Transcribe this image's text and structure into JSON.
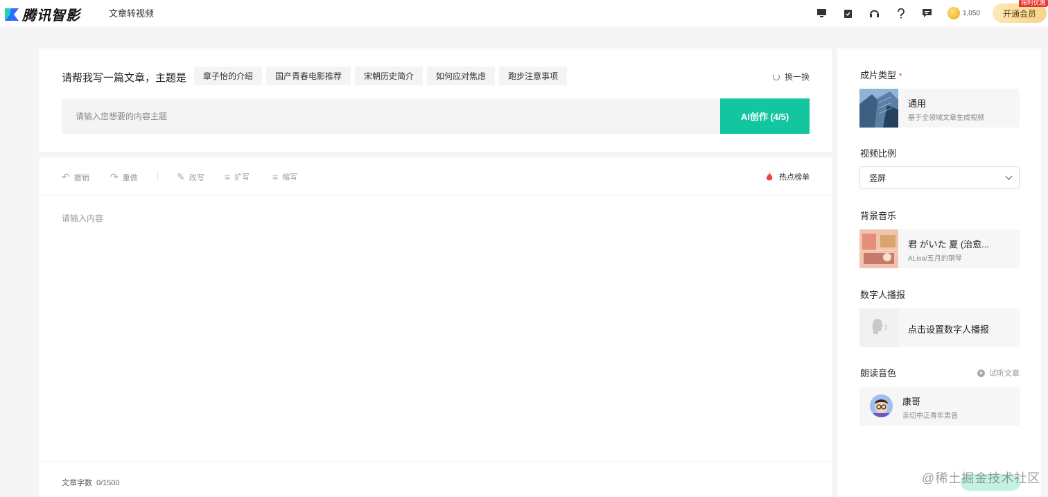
{
  "header": {
    "brand": "腾讯智影",
    "page_name": "文章转视频",
    "icons": [
      "monitor-icon",
      "clipboard-icon",
      "headset-icon",
      "help-icon",
      "message-icon"
    ],
    "coins": "1,050",
    "vip_label": "开通会员",
    "vip_tag": "限时优惠"
  },
  "prompt": {
    "label": "请帮我写一篇文章，主题是",
    "chips": [
      "章子怡的介绍",
      "国产青春电影推荐",
      "宋朝历史简介",
      "如何应对焦虑",
      "跑步注意事项"
    ],
    "refresh_label": "换一换",
    "input_placeholder": "请输入您想要的内容主题",
    "ai_button": "AI创作 (4/5)"
  },
  "editor": {
    "tools": {
      "undo": "撤销",
      "redo": "重做",
      "rewrite": "改写",
      "expand": "扩写",
      "shorten": "缩写"
    },
    "hot_list": "热点榜单",
    "content_placeholder": "请输入内容",
    "word_count_label": "文章字数",
    "word_count_value": "0/1500"
  },
  "sidebar": {
    "film_type": {
      "title": "成片类型",
      "required_mark": "*",
      "name": "通用",
      "desc": "基于全领域文章生成视频"
    },
    "ratio": {
      "title": "视频比例",
      "value": "竖屏"
    },
    "music": {
      "title": "背景音乐",
      "name": "君 がいた 夏 (治愈...",
      "artist": "ALisa/五月的钢琴"
    },
    "digital_human": {
      "title": "数字人播报",
      "action": "点击设置数字人播报"
    },
    "voice": {
      "title": "朗读音色",
      "listen_label": "试听文章",
      "name": "康哥",
      "desc": "亲切中正青年男音"
    }
  },
  "watermark": "@稀土掘金技术社区",
  "colors": {
    "accent": "#14c6a0",
    "vip_gold": "#f6d489",
    "required": "#e6322d"
  }
}
